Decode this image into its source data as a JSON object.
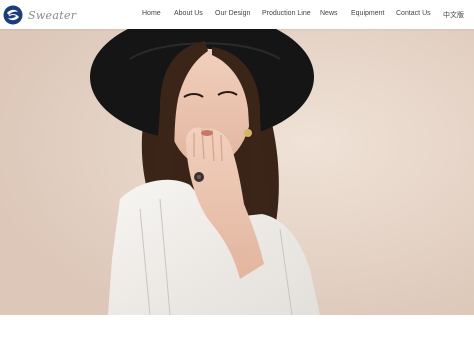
{
  "brand": {
    "name": "Sweater",
    "logo_icon": "swirl-logo-icon",
    "logo_color": "#1b3d7a"
  },
  "nav": {
    "items": [
      {
        "label": "Home"
      },
      {
        "label": "About Us"
      },
      {
        "label": "Our Design"
      },
      {
        "label": "Production Line"
      },
      {
        "label": "News"
      },
      {
        "label": "Equipment"
      },
      {
        "label": "Contact Us"
      },
      {
        "label": "中文版"
      }
    ]
  },
  "hero": {
    "image": "woman-in-black-hat-blowing-kiss-photo",
    "background_color": "#e5d4c8"
  }
}
